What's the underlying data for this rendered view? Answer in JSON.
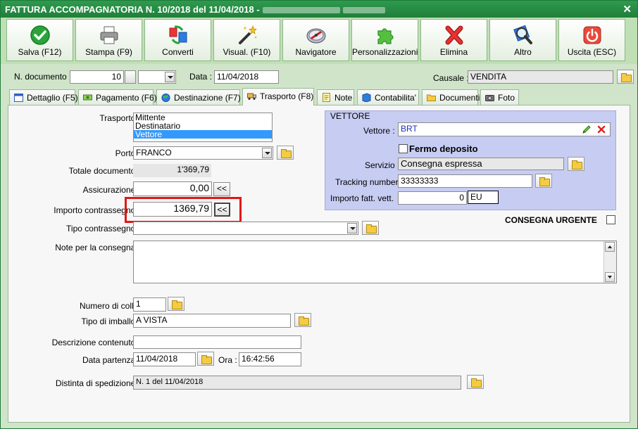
{
  "window": {
    "title": "FATTURA ACCOMPAGNATORIA N. 10/2018 del 11/04/2018 -"
  },
  "toolbar": [
    {
      "label": "Salva (F12)",
      "icon": "checkmark-icon"
    },
    {
      "label": "Stampa (F9)",
      "icon": "printer-icon"
    },
    {
      "label": "Converti",
      "icon": "convert-icon"
    },
    {
      "label": "Visual. (F10)",
      "icon": "magic-wand-icon"
    },
    {
      "label": "Navigatore",
      "icon": "compass-icon"
    },
    {
      "label": "Personalizzazioni",
      "icon": "puzzle-icon"
    },
    {
      "label": "Elimina",
      "icon": "delete-x-icon"
    },
    {
      "label": "Altro",
      "icon": "magnifier-icon"
    },
    {
      "label": "Uscita (ESC)",
      "icon": "power-icon"
    }
  ],
  "header": {
    "ndoc_label": "N. documento :",
    "ndoc_value": "10",
    "data_label": "Data :",
    "data_value": "11/04/2018",
    "causale_label": "Causale :",
    "causale_value": "VENDITA"
  },
  "tabs": [
    {
      "label": "Dettaglio (F5)",
      "icon": "calendar-icon"
    },
    {
      "label": "Pagamento (F6)",
      "icon": "money-icon"
    },
    {
      "label": "Destinazione (F7)",
      "icon": "globe-icon"
    },
    {
      "label": "Trasporto (F8)",
      "icon": "truck-icon",
      "active": true
    },
    {
      "label": "Note",
      "icon": "note-icon"
    },
    {
      "label": "Contabilita'",
      "icon": "book-icon"
    },
    {
      "label": "Documenti",
      "icon": "folder-icon"
    },
    {
      "label": "Foto",
      "icon": "camera-icon"
    }
  ],
  "trasporto": {
    "trasporto_label": "Trasporto :",
    "trasporto_options": [
      "Mittente",
      "Destinatario",
      "Vettore"
    ],
    "trasporto_selected": "Vettore",
    "porto_label": "Porto :",
    "porto_value": "FRANCO",
    "totale_label": "Totale documento :",
    "totale_value": "1'369,79",
    "assicurazione_label": "Assicurazione :",
    "assicurazione_value": "0,00",
    "contrassegno_label": "Importo contrassegno :",
    "contrassegno_value": "1369,79",
    "copy_button": "<<",
    "tipo_contrassegno_label": "Tipo contrassegno :",
    "tipo_contrassegno_value": "",
    "note_label": "Note per la consegna :",
    "note_value": "",
    "colli_label": "Numero di colli :",
    "colli_value": "1",
    "imballo_label": "Tipo di imballo :",
    "imballo_value": "A VISTA",
    "descrizione_label": "Descrizione contenuto :",
    "descrizione_value": "",
    "partenza_label": "Data partenza :",
    "partenza_value": "11/04/2018",
    "ora_label": "Ora :",
    "ora_value": "16:42:56",
    "distinta_label": "Distinta di spedizione :",
    "distinta_value": "N. 1 del 11/04/2018",
    "urgente_label": "CONSEGNA URGENTE"
  },
  "vettore": {
    "section_title": "VETTORE",
    "vettore_label": "Vettore :",
    "vettore_value": "BRT",
    "fermo_label": "Fermo deposito",
    "servizio_label": "Servizio :",
    "servizio_value": "Consegna espressa",
    "tracking_label": "Tracking number :",
    "tracking_value": "33333333",
    "importo_label": "Importo fatt. vett.",
    "importo_value": "0",
    "currency_value": "EU"
  },
  "colors": {
    "title_green": "#1f7f3b",
    "bg_green": "#cfe4c8",
    "vettore_bg": "#c7ccf2",
    "highlight_red": "#e01818",
    "selection_blue": "#3399ff"
  }
}
